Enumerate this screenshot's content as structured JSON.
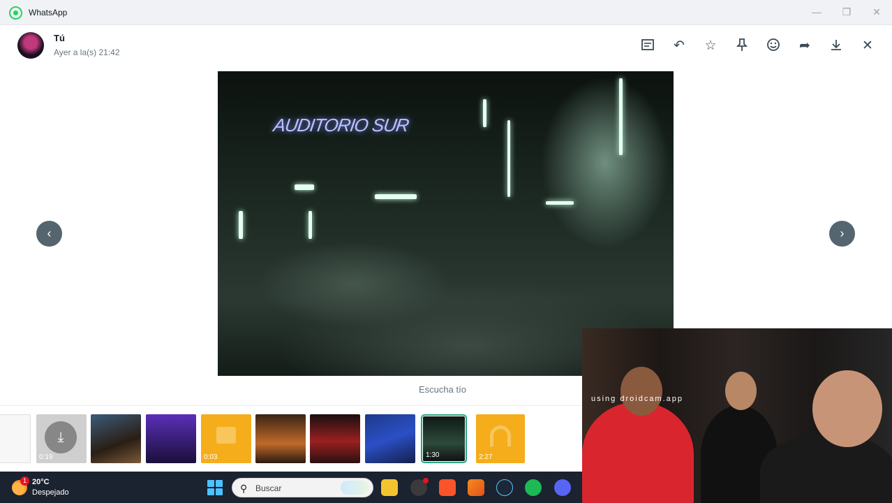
{
  "window": {
    "title": "WhatsApp"
  },
  "viewer": {
    "sender": "Tú",
    "timestamp": "Ayer a la(s) 21:42",
    "caption": "Escucha tío",
    "video_sign_text": "AUDITORIO SUR"
  },
  "toolbar": {
    "icons": [
      "message-icon",
      "reply-icon",
      "star-icon",
      "pin-icon",
      "emoji-icon",
      "forward-icon",
      "download-icon",
      "close-icon"
    ]
  },
  "navigation": {
    "prev": "‹",
    "next": "›"
  },
  "media_strip": {
    "items": [
      {
        "duration": ""
      },
      {
        "duration": "0:19"
      },
      {
        "duration": ""
      },
      {
        "duration": ""
      },
      {
        "duration": "0:03"
      },
      {
        "duration": ""
      },
      {
        "duration": ""
      },
      {
        "duration": ""
      },
      {
        "duration": "1:30"
      },
      {
        "duration": "2:27"
      }
    ]
  },
  "webcam": {
    "watermark": "using droidcam.app"
  },
  "taskbar": {
    "weather_badge": "1",
    "temperature": "20°C",
    "condition": "Despejado",
    "search_placeholder": "Buscar"
  },
  "colors": {
    "accent": "#25d366",
    "selected_border": "#25a884",
    "taskbar": "#1b2230"
  }
}
